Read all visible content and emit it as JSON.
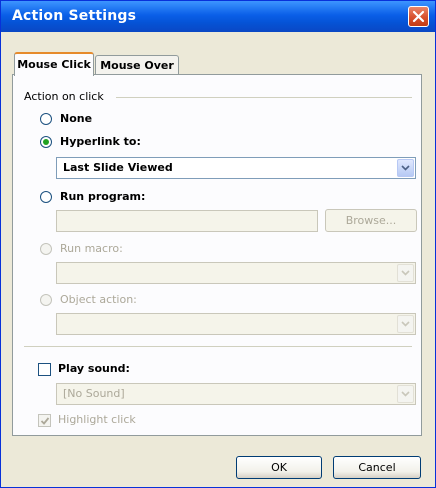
{
  "window": {
    "title": "Action Settings"
  },
  "tabs": [
    {
      "label": "Mouse Click",
      "active": true
    },
    {
      "label": "Mouse Over",
      "active": false
    }
  ],
  "group": {
    "label": "Action on click"
  },
  "options": {
    "none": {
      "label": "None",
      "selected": false
    },
    "hyperlink": {
      "label": "Hyperlink to:",
      "selected": true,
      "value": "Last Slide Viewed"
    },
    "run_program": {
      "label": "Run program:",
      "selected": false,
      "value": "",
      "browse_label": "Browse..."
    },
    "run_macro": {
      "label": "Run macro:",
      "selected": false,
      "value": ""
    },
    "object_action": {
      "label": "Object action:",
      "selected": false,
      "value": ""
    }
  },
  "play_sound": {
    "label": "Play sound:",
    "checked": false,
    "value": "[No Sound]"
  },
  "highlight_click": {
    "label": "Highlight click",
    "checked": true
  },
  "buttons": {
    "ok": "OK",
    "cancel": "Cancel"
  },
  "colors": {
    "titlebar": "#0a5fe8",
    "close": "#d8502d",
    "tab_accent": "#e68b2c",
    "radio_dot": "#21a121"
  }
}
